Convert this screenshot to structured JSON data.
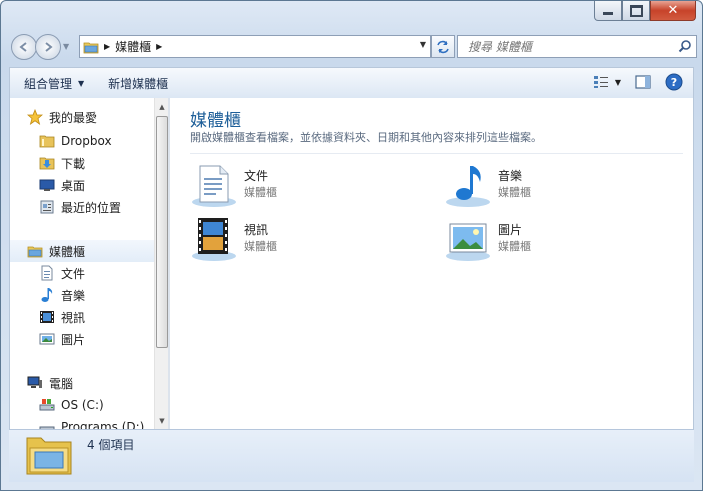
{
  "window": {
    "accent": "#1e5f99"
  },
  "address": {
    "crumb": "媒體櫃"
  },
  "search": {
    "placeholder": "搜尋 媒體櫃"
  },
  "toolbar": {
    "organize": "組合管理",
    "new_library": "新增媒體櫃"
  },
  "nav": {
    "favorites_header": "我的最愛",
    "favorites": [
      {
        "label": "Dropbox",
        "icon": "dropbox-folder-icon"
      },
      {
        "label": "下載",
        "icon": "downloads-icon"
      },
      {
        "label": "桌面",
        "icon": "desktop-icon"
      },
      {
        "label": "最近的位置",
        "icon": "recent-places-icon"
      }
    ],
    "libraries_header": "媒體櫃",
    "libraries": [
      {
        "label": "文件",
        "icon": "documents-icon"
      },
      {
        "label": "音樂",
        "icon": "music-icon"
      },
      {
        "label": "視訊",
        "icon": "video-icon"
      },
      {
        "label": "圖片",
        "icon": "pictures-icon"
      }
    ],
    "computer_header": "電腦",
    "drives": [
      {
        "label": "OS (C:)",
        "icon": "drive-icon"
      },
      {
        "label": "Programs (D:)",
        "icon": "drive-icon"
      }
    ]
  },
  "content": {
    "title": "媒體櫃",
    "description": "開啟媒體櫃查看檔案，並依據資料夾、日期和其他內容來排列這些檔案。",
    "libraries": [
      {
        "name": "文件",
        "type": "媒體櫃"
      },
      {
        "name": "音樂",
        "type": "媒體櫃"
      },
      {
        "name": "視訊",
        "type": "媒體櫃"
      },
      {
        "name": "圖片",
        "type": "媒體櫃"
      }
    ]
  },
  "details": {
    "item_count": "4 個項目"
  }
}
